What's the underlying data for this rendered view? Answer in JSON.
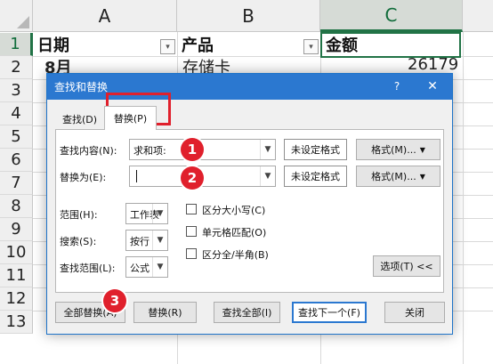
{
  "sheet": {
    "columns": [
      "A",
      "B",
      "C"
    ],
    "rows": [
      "1",
      "2",
      "3",
      "4",
      "5",
      "6",
      "7",
      "8",
      "9",
      "10",
      "11",
      "12",
      "13"
    ],
    "headers": {
      "date": "日期",
      "product": "产品",
      "amount": "金额"
    },
    "row2": {
      "date": "8月",
      "product": "存储卡",
      "amount": "26179"
    }
  },
  "dialog": {
    "title": "查找和替换",
    "help": "?",
    "close": "✕",
    "tabs": {
      "find": "查找(D)",
      "replace": "替换(P)"
    },
    "find_label": "查找内容(N):",
    "find_value": "求和项:",
    "replace_label": "替换为(E):",
    "replace_value": "",
    "no_format_1": "未设定格式",
    "no_format_2": "未设定格式",
    "format_btn_1": "格式(M)...",
    "format_btn_2": "格式(M)...",
    "within_label": "范围(H):",
    "within_value": "工作表",
    "search_label": "搜索(S):",
    "search_value": "按行",
    "lookin_label": "查找范围(L):",
    "lookin_value": "公式",
    "match_case": "区分大小写(C)",
    "match_cell": "单元格匹配(O)",
    "match_width": "区分全/半角(B)",
    "options_btn": "选项(T) <<",
    "replace_all": "全部替换(A)",
    "replace": "替换(R)",
    "find_all": "查找全部(I)",
    "find_next": "查找下一个(F)",
    "close_btn": "关闭"
  },
  "markers": [
    "1",
    "2",
    "3"
  ],
  "colors": {
    "accent": "#2b78d0",
    "excel_green": "#217346",
    "marker_red": "#e0202c"
  }
}
